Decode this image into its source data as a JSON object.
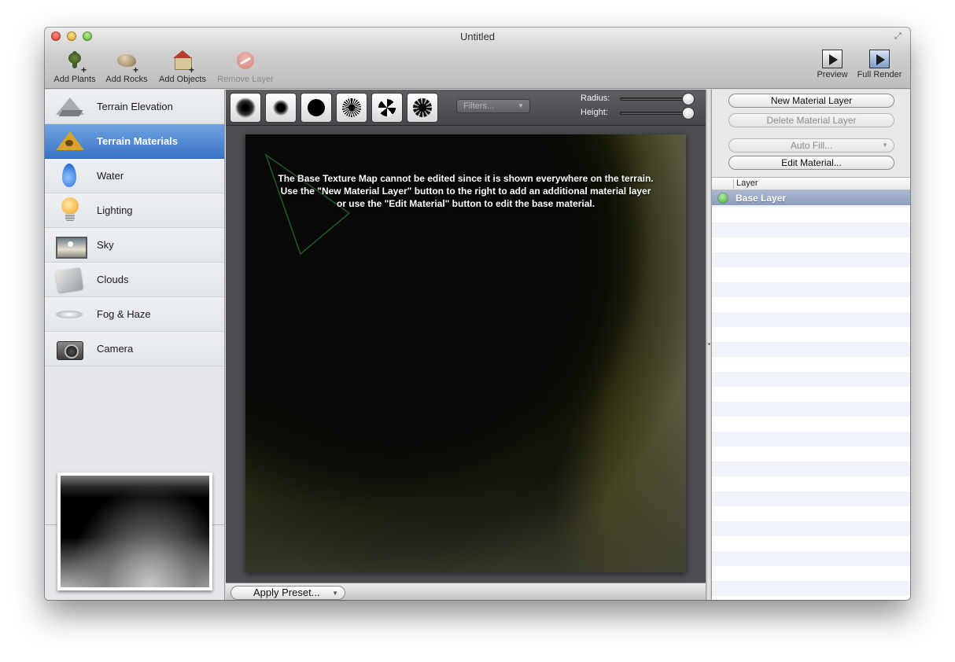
{
  "window": {
    "title": "Untitled"
  },
  "toolbar": {
    "left": [
      {
        "label": "Add Plants",
        "icon": "plant-icon",
        "enabled": true
      },
      {
        "label": "Add Rocks",
        "icon": "rock-icon",
        "enabled": true
      },
      {
        "label": "Add Objects",
        "icon": "object-icon",
        "enabled": true
      },
      {
        "label": "Remove Layer",
        "icon": "remove-layer-icon",
        "enabled": false
      }
    ],
    "right": [
      {
        "label": "Preview",
        "icon": "preview-icon"
      },
      {
        "label": "Full Render",
        "icon": "full-render-icon"
      }
    ]
  },
  "sidebar": {
    "items": [
      {
        "label": "Terrain Elevation",
        "icon": "terrain-elevation-icon",
        "active": false
      },
      {
        "label": "Terrain Materials",
        "icon": "terrain-materials-icon",
        "active": true
      },
      {
        "label": "Water",
        "icon": "water-drop-icon",
        "active": false
      },
      {
        "label": "Lighting",
        "icon": "light-bulb-icon",
        "active": false
      },
      {
        "label": "Sky",
        "icon": "sky-icon",
        "active": false
      },
      {
        "label": "Clouds",
        "icon": "clouds-icon",
        "active": false
      },
      {
        "label": "Fog & Haze",
        "icon": "fog-icon",
        "active": false
      },
      {
        "label": "Camera",
        "icon": "camera-icon",
        "active": false
      }
    ]
  },
  "editor": {
    "brushes": [
      "soft-brush-large",
      "soft-brush-small",
      "hard-brush",
      "noise-brush",
      "fan-brush",
      "splatter-brush"
    ],
    "filters": {
      "placeholder": "Filters..."
    },
    "radius_label": "Radius:",
    "height_label": "Height:",
    "radius_value": 1.0,
    "height_value": 1.0,
    "message": "The Base Texture Map cannot be edited since it is shown everywhere on the terrain. Use the \"New Material Layer\" button to the right to add an additional material layer or use the \"Edit Material\" button to edit the base material.",
    "apply_preset": "Apply Preset..."
  },
  "right_panel": {
    "new_layer": "New Material Layer",
    "delete_layer": "Delete Material Layer",
    "auto_fill": "Auto Fill...",
    "edit_material": "Edit Material...",
    "table_header": "Layer",
    "layers": [
      {
        "name": "Base Layer",
        "selected": true,
        "status_color": "#3ca830"
      }
    ]
  },
  "colors": {
    "selection_blue": "#3a74c8",
    "canvas_dark": "#0a0a04"
  }
}
